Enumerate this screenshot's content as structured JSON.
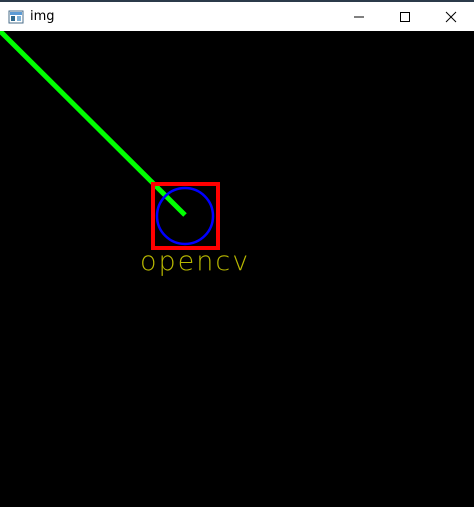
{
  "window": {
    "title": "img",
    "controls": {
      "minimize_icon": "minimize-icon",
      "maximize_icon": "maximize-icon",
      "close_icon": "close-icon"
    }
  },
  "canvas": {
    "background": "#000000",
    "shapes": {
      "line_color": "#00ff00",
      "rectangle_color": "#ff0000",
      "circle_color": "#0000ff",
      "text_color": "#b8b800"
    },
    "text": "opencv"
  }
}
